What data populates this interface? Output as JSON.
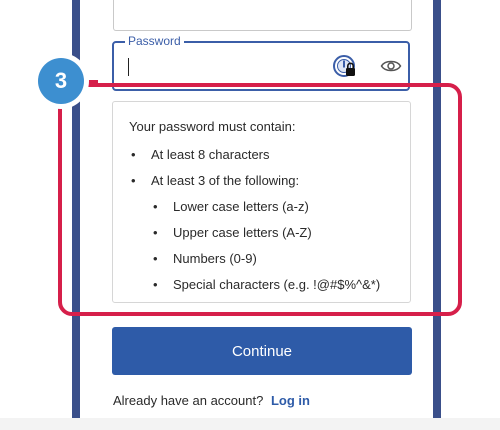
{
  "form": {
    "password_label": "Password",
    "password_value": "",
    "continue_label": "Continue"
  },
  "requirements": {
    "title": "Your password must contain:",
    "items": [
      {
        "text": "At least 8 characters"
      },
      {
        "text": "At least 3 of the following:"
      }
    ],
    "subitems": [
      {
        "text": "Lower case letters (a-z)"
      },
      {
        "text": "Upper case letters (A-Z)"
      },
      {
        "text": "Numbers (0-9)"
      },
      {
        "text": "Special characters (e.g. !@#$%^&*)"
      }
    ],
    "bullet": "•"
  },
  "footer": {
    "prompt": "Already have an account?",
    "login_link": "Log in"
  },
  "annotation": {
    "step_number": "3"
  },
  "colors": {
    "accent": "#2e5ba8",
    "highlight": "#d61f4a",
    "badge": "#3d8fd0",
    "frame": "#3a4f8a"
  },
  "icons": {
    "password_manager": "password-manager-icon",
    "show_password": "eye-icon"
  }
}
